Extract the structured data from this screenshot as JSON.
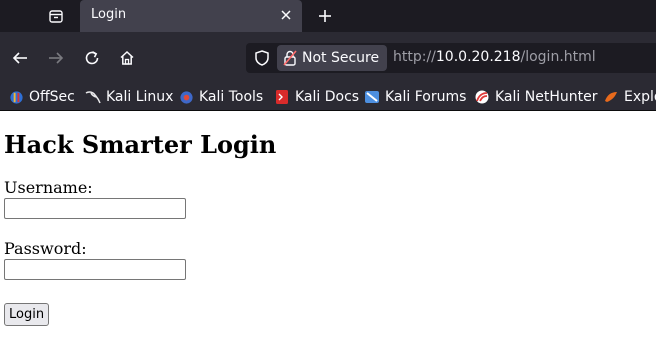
{
  "browser": {
    "tab": {
      "title": "Login"
    },
    "url": {
      "security_label": "Not Secure",
      "prefix": "http://",
      "host": "10.0.20.218",
      "path": "/login.html"
    },
    "bookmarks": [
      {
        "label": "OffSec",
        "icon": "offsec-icon",
        "color": "#3b7be0"
      },
      {
        "label": "Kali Linux",
        "icon": "kali-dragon-icon",
        "color": "#ffffff"
      },
      {
        "label": "Kali Tools",
        "icon": "kali-tools-icon",
        "color": "#e0463a"
      },
      {
        "label": "Kali Docs",
        "icon": "kali-docs-icon",
        "color": "#d92b2b"
      },
      {
        "label": "Kali Forums",
        "icon": "kali-forums-icon",
        "color": "#5aa0e8"
      },
      {
        "label": "Kali NetHunter",
        "icon": "kali-nethunter-icon",
        "color": "#e03a3a"
      },
      {
        "label": "Explo",
        "icon": "exploit-db-icon",
        "color": "#e86a1c"
      }
    ]
  },
  "page": {
    "heading": "Hack Smarter Login",
    "username_label": "Username:",
    "username_value": "",
    "password_label": "Password:",
    "password_value": "",
    "submit_label": "Login"
  }
}
